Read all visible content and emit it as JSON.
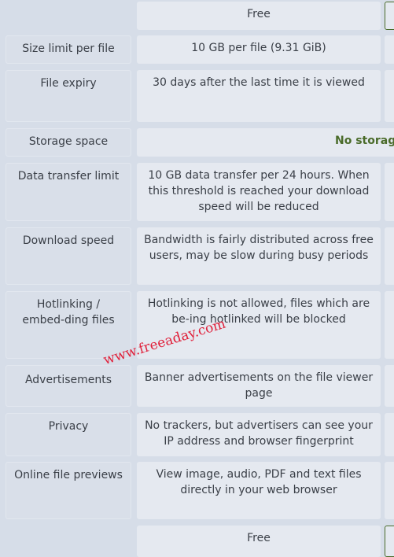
{
  "plan_header": "Free",
  "rows": [
    {
      "label": "Size limit per file",
      "value": "10 GB per file (9.31 GiB)"
    },
    {
      "label": "File expiry",
      "value": "30 days after the last time it is viewed"
    },
    {
      "label": "Storage space",
      "value": "No storag"
    },
    {
      "label": "Data transfer limit",
      "value": "10 GB data transfer per 24 hours. When this threshold is reached your download speed will be reduced"
    },
    {
      "label": "Download speed",
      "value": "Bandwidth is fairly distributed across free users, may be slow during busy periods"
    },
    {
      "label": "Hotlinking / embed-ding files",
      "value": "Hotlinking is not allowed, files which are be-ing hotlinked will be blocked"
    },
    {
      "label": "Advertisements",
      "value": "Banner advertisements on the file viewer page"
    },
    {
      "label": "Privacy",
      "value": "No trackers, but advertisers can see your IP address and browser fingerprint"
    },
    {
      "label": "Online file previews",
      "value": "View image, audio, PDF and text files directly in your web browser"
    }
  ],
  "plan_footer": "Free",
  "watermark": "www.freeaday.com",
  "colors": {
    "accent_green": "#4a6b2a",
    "watermark": "#e0203a"
  }
}
